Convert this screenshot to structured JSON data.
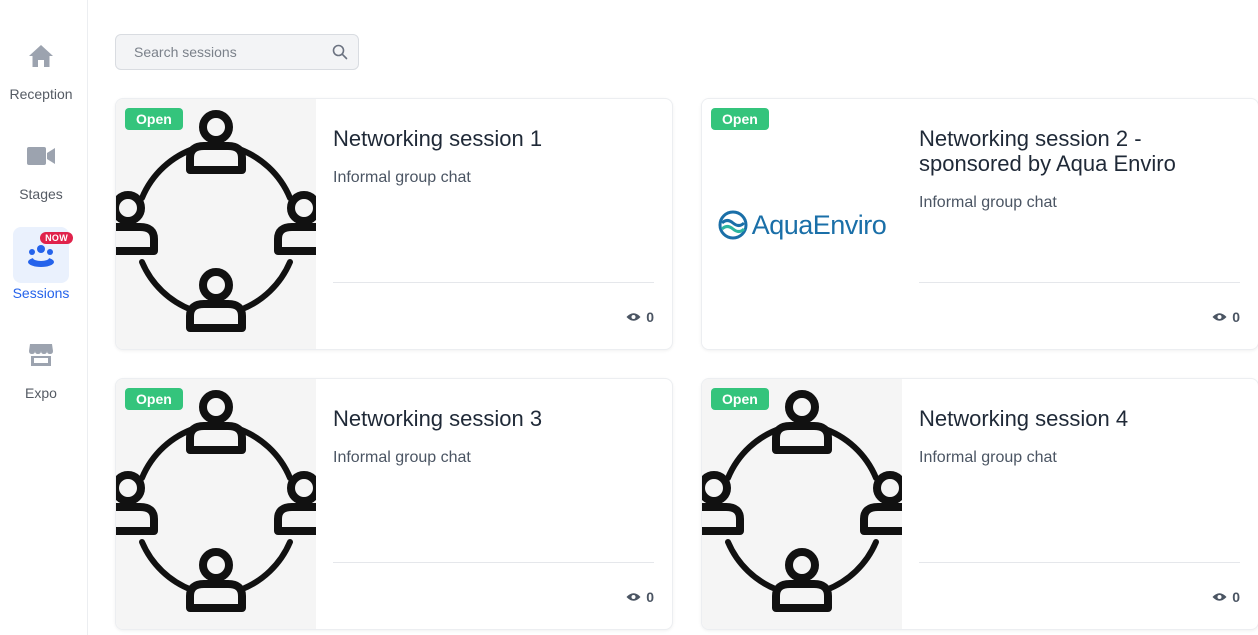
{
  "sidebar": {
    "items": [
      {
        "label": "Reception",
        "icon": "home-icon"
      },
      {
        "label": "Stages",
        "icon": "video-camera-icon"
      },
      {
        "label": "Sessions",
        "icon": "people-group-icon",
        "badge": "NOW",
        "active": true
      },
      {
        "label": "Expo",
        "icon": "storefront-icon"
      }
    ]
  },
  "search": {
    "placeholder": "Search sessions"
  },
  "sessions": [
    {
      "badge": "Open",
      "title": "Networking session 1",
      "description": "Informal group chat",
      "views": "0",
      "thumb": "network-circle-icon"
    },
    {
      "badge": "Open",
      "title": "Networking session 2 - sponsored by Aqua Enviro",
      "description": "Informal group chat",
      "views": "0",
      "thumb": "aquaenviro-logo",
      "logo_text": "AquaEnviro"
    },
    {
      "badge": "Open",
      "title": "Networking session 3",
      "description": "Informal group chat",
      "views": "0",
      "thumb": "network-circle-icon"
    },
    {
      "badge": "Open",
      "title": "Networking session 4",
      "description": "Informal group chat",
      "views": "0",
      "thumb": "network-circle-icon"
    }
  ],
  "colors": {
    "accent": "#2563eb",
    "open_badge": "#34c47c",
    "now_badge": "#e0224b",
    "logo": "#1a6fa8"
  }
}
